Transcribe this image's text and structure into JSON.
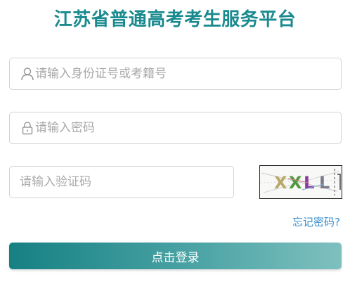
{
  "header": {
    "title": "江苏省普通高考考生服务平台"
  },
  "form": {
    "id_field": {
      "placeholder": "请输入身份证号或考籍号",
      "icon": "user-icon"
    },
    "password_field": {
      "placeholder": "请输入密码",
      "icon": "lock-icon"
    },
    "captcha_field": {
      "placeholder": "请输入验证码"
    },
    "captcha_image": {
      "text": "XXLL"
    },
    "forgot_password_label": "忘记密码?",
    "login_button_label": "点击登录"
  },
  "colors": {
    "title": "#1a8a8f",
    "link": "#3a8fd0",
    "button_start": "#168083",
    "button_end": "#7fc0bf"
  }
}
